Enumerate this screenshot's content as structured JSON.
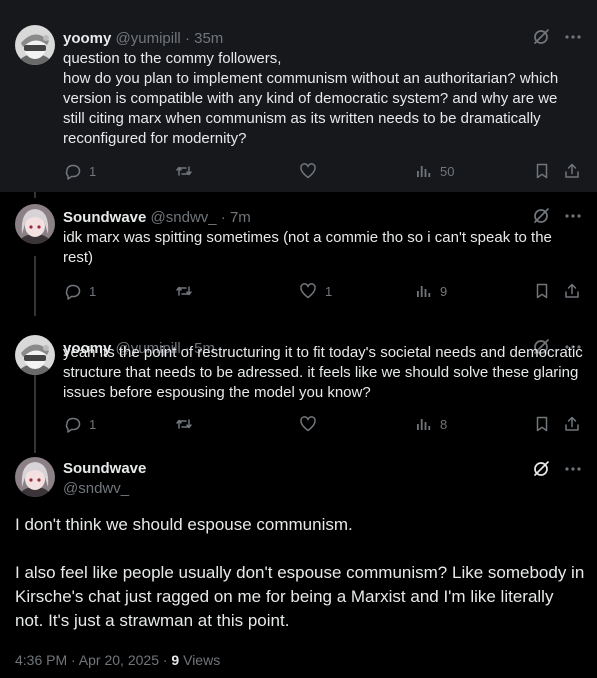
{
  "thread": [
    {
      "name": "yoomy",
      "handle": "@yumipill",
      "sep": "·",
      "time": "35m",
      "lines": [
        "question to the commy followers,",
        "how do you plan to implement communism without an authoritarian? which version is compatible with any kind of democratic system? and why are we still citing marx when communism as its written needs to be dramatically reconfigured for modernity?"
      ],
      "replies": "1",
      "reposts": "",
      "likes": "",
      "views": "50"
    },
    {
      "name": "Soundwave",
      "handle": "@sndwv_",
      "sep": "·",
      "time": "7m",
      "lines": [
        "idk marx was spitting sometimes (not a commie tho so i can't speak to the rest)"
      ],
      "replies": "1",
      "reposts": "",
      "likes": "1",
      "views": "9"
    },
    {
      "name": "yoomy",
      "handle": "@yumipill",
      "sep": "·",
      "time": "5m",
      "lines": [
        "yeah its the point of restructuring it to fit today's societal needs and democratic structure that needs to be adressed. it feels like we should solve these glaring issues before espousing the model you know?"
      ],
      "replies": "1",
      "reposts": "",
      "likes": "",
      "views": "8"
    }
  ],
  "main": {
    "name": "Soundwave",
    "handle": "@sndwv_",
    "paragraphs": [
      "I don't think we should espouse communism.",
      "I also feel like people usually don't espouse communism? Like somebody in Kirsche's chat just ragged on me for being a Marxist and I'm like literally not. It's just a strawman at this point."
    ],
    "time": "4:36 PM · Apr 20, 2025 ·",
    "views_count": "9",
    "views_label": "Views"
  },
  "icons": {
    "grok": "grok-icon",
    "more": "more-icon",
    "reply": "reply-icon",
    "repost": "repost-icon",
    "like": "like-icon",
    "views": "views-icon",
    "bookmark": "bookmark-icon",
    "share": "share-icon"
  },
  "colors": {
    "background": "#000000",
    "highlight": "#16181c",
    "text": "#e7e9ea",
    "muted": "#71767b",
    "line": "#333639"
  }
}
